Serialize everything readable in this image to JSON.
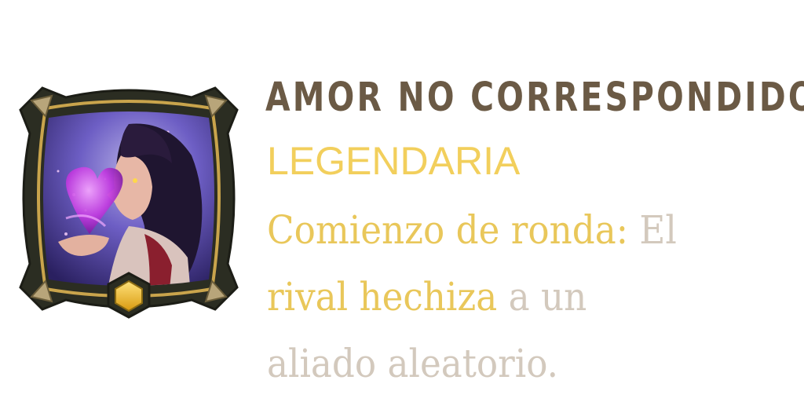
{
  "card": {
    "title": "AMOR NO CORRESPONDIDO",
    "rarity": "LEGENDARIA",
    "description": {
      "lines": [
        [
          {
            "text": "Comienzo de ronda:",
            "style": "keyword"
          },
          {
            "text": " El",
            "style": "body"
          }
        ],
        [
          {
            "text": "rival hechiza",
            "style": "keyword"
          },
          {
            "text": " a un",
            "style": "body"
          }
        ],
        [
          {
            "text": "aliado aleatorio.",
            "style": "body"
          }
        ]
      ]
    },
    "art_icon": "heart-kiss-portrait-icon",
    "frame_gem_icon": "hexagon-gem-icon"
  },
  "colors": {
    "title": "#6b5a45",
    "rarity": "#f2cf5c",
    "keyword": "#e9c75a",
    "body": "#d3c9bd",
    "frame": "#2b2d22",
    "frame_trim": "#c9a44c",
    "art_bg": "#5a4fb0",
    "gem": "#f2c12e"
  }
}
